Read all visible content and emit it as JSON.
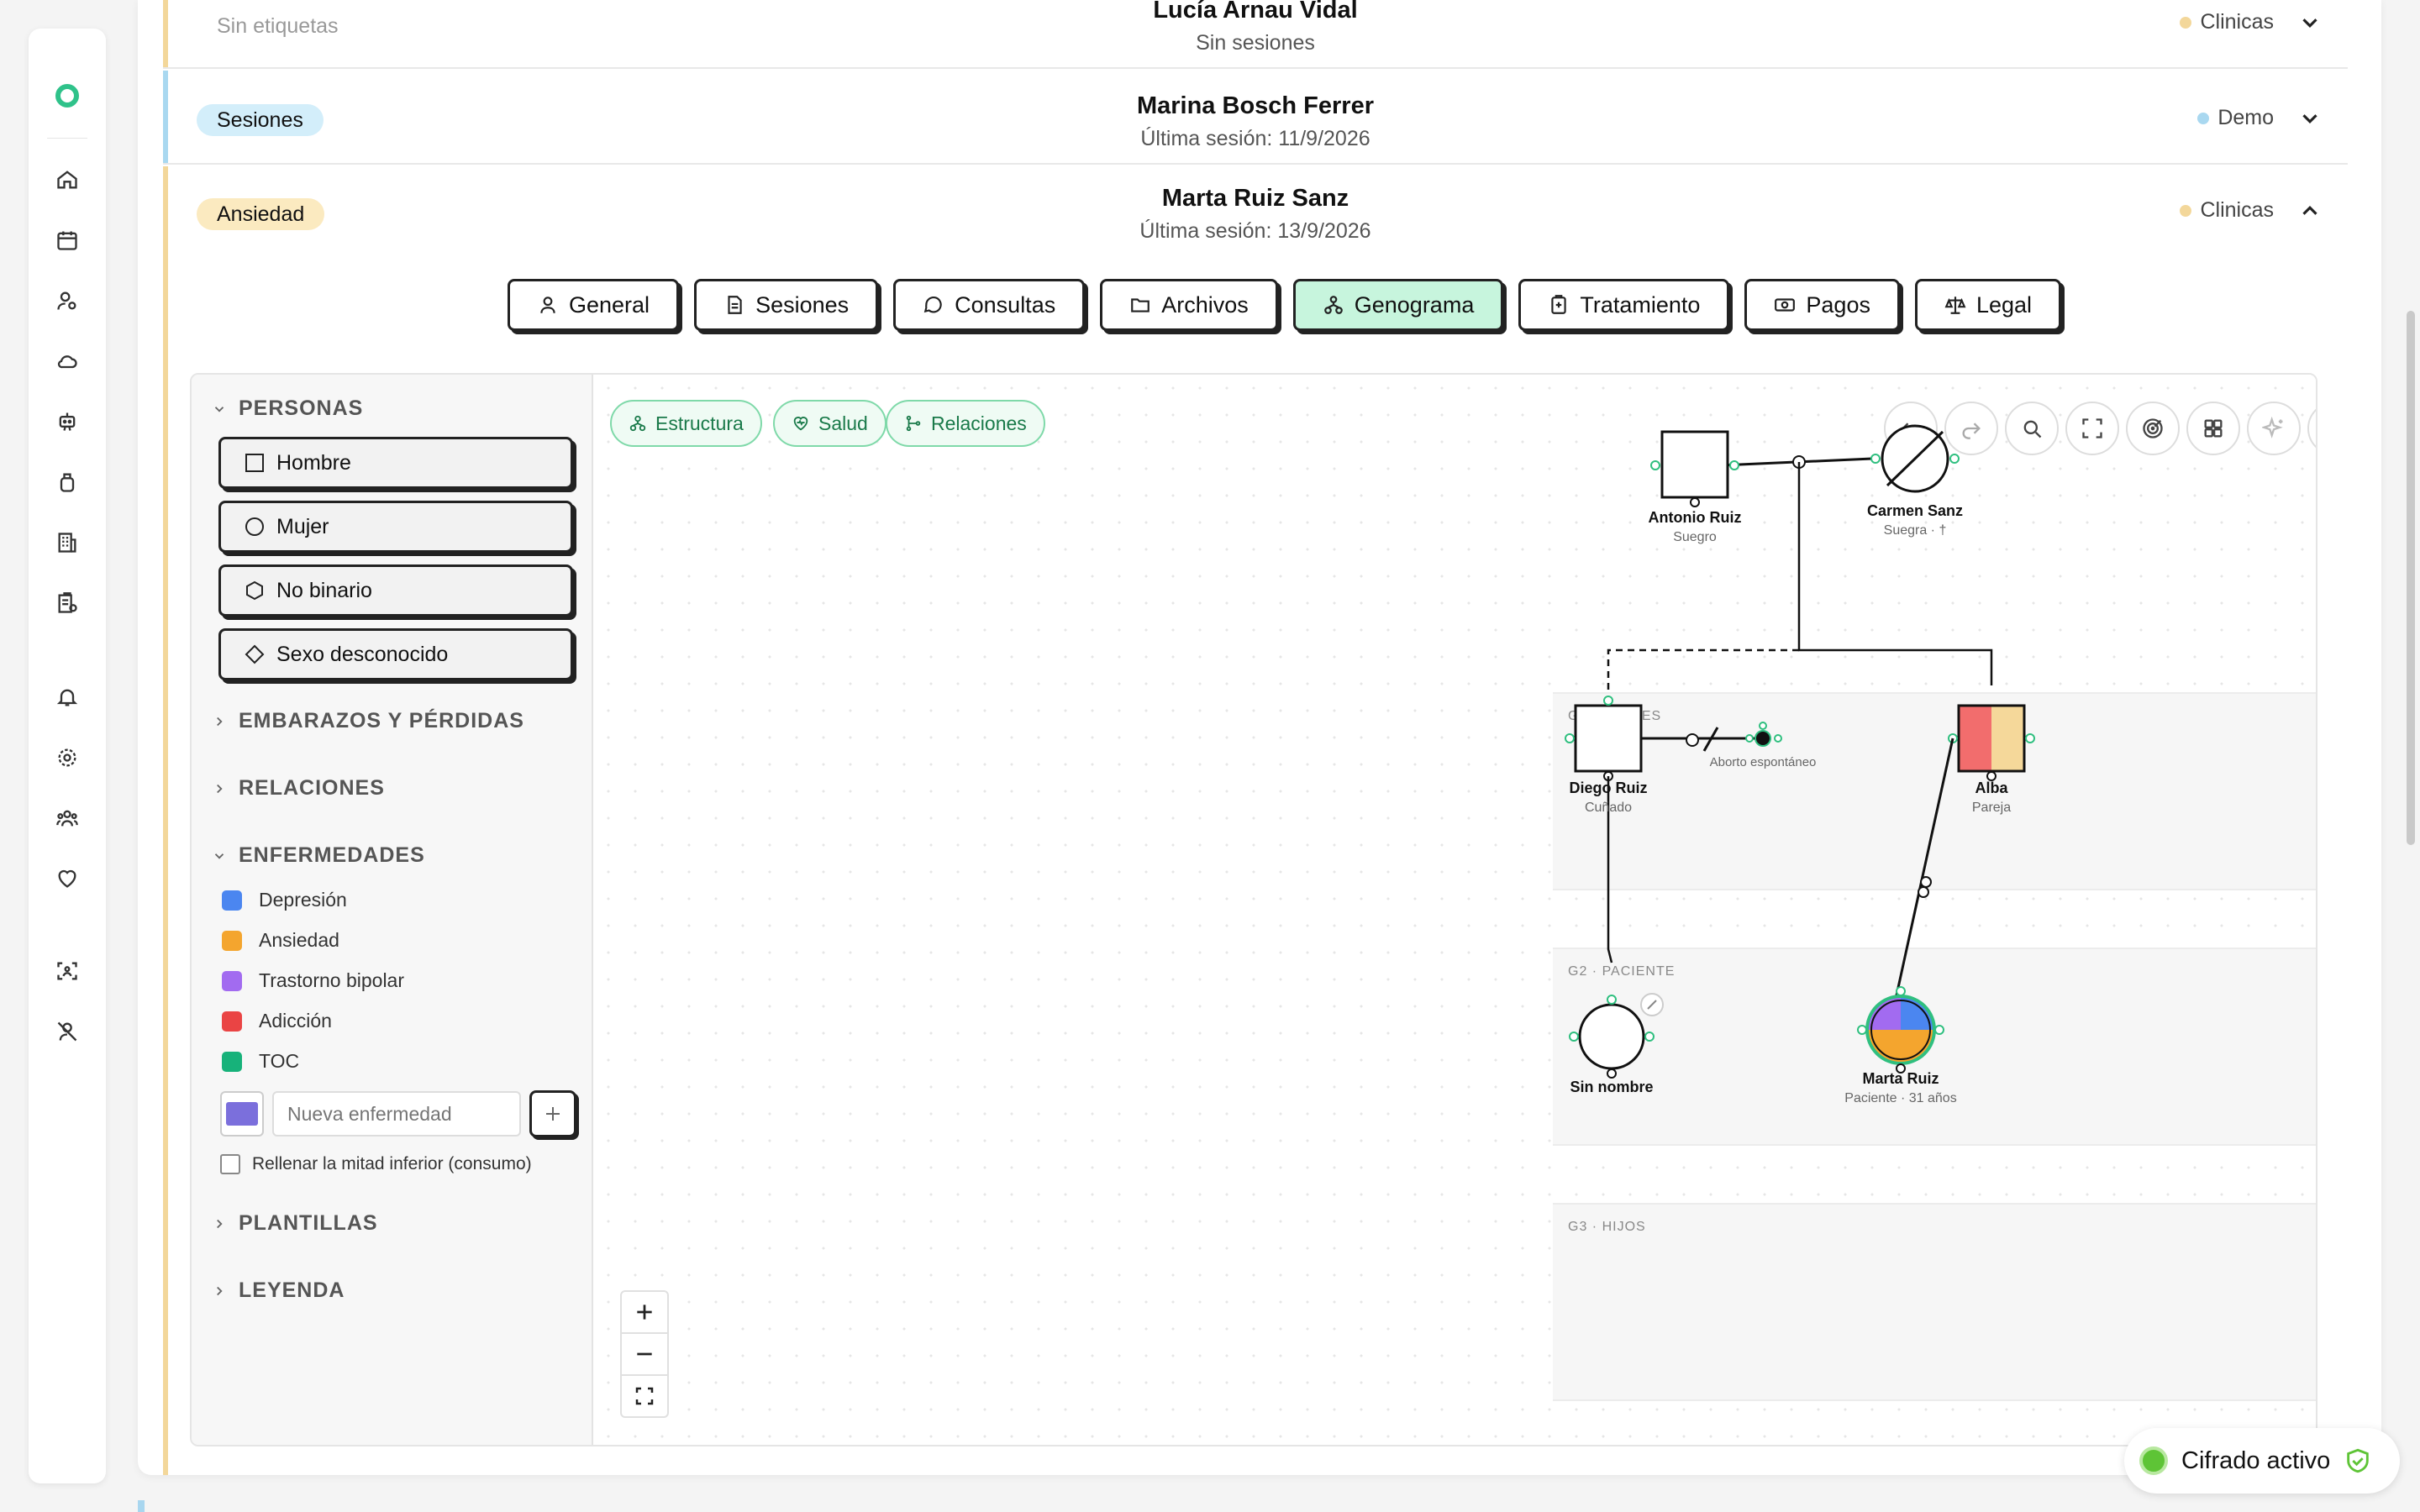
{
  "patients": [
    {
      "tag": "Sin etiquetas",
      "name": "Lucía Arnau Vidal",
      "sub": "Sin sesiones",
      "status": "Clinicas",
      "stripe": "#f3d79a",
      "status_color": "#f3d79a"
    },
    {
      "tag": "Sesiones",
      "name": "Marina Bosch Ferrer",
      "sub": "Última sesión: 11/9/2026",
      "status": "Demo",
      "stripe": "#a9d8f0",
      "status_color": "#a9d8f0",
      "tag_color": "#d3eefa"
    },
    {
      "tag": "Ansiedad",
      "name": "Marta Ruiz Sanz",
      "sub": "Última sesión: 13/9/2026",
      "status": "Clinicas",
      "stripe": "#f3d79a",
      "status_color": "#f3d79a",
      "tag_color": "#fbeac0"
    }
  ],
  "tabs": [
    "General",
    "Sesiones",
    "Consultas",
    "Archivos",
    "Genograma",
    "Tratamiento",
    "Pagos",
    "Legal"
  ],
  "active_tab": "Genograma",
  "sidebar": {
    "personas_title": "PERSONAS",
    "person_buttons": [
      "Hombre",
      "Mujer",
      "No binario",
      "Sexo desconocido"
    ],
    "embarazos_title": "EMBARAZOS Y PÉRDIDAS",
    "relaciones_title": "RELACIONES",
    "enfermedades_title": "ENFERMEDADES",
    "diseases": [
      {
        "name": "Depresión",
        "color": "#4b86f0"
      },
      {
        "name": "Ansiedad",
        "color": "#f4a52e"
      },
      {
        "name": "Trastorno bipolar",
        "color": "#a26bf0"
      },
      {
        "name": "Adicción",
        "color": "#ea4444"
      },
      {
        "name": "TOC",
        "color": "#17b27a"
      }
    ],
    "new_disease_placeholder": "Nueva enfermedad",
    "new_disease_color": "#7b6fdc",
    "half_fill_label": "Rellenar la mitad inferior (consumo)",
    "plantillas_title": "PLANTILLAS",
    "leyenda_title": "LEYENDA"
  },
  "canvas": {
    "chips": [
      "Estructura",
      "Salud",
      "Relaciones"
    ],
    "tools": [
      "undo-icon",
      "redo-icon",
      "search-icon",
      "fullscreen-icon",
      "target-icon",
      "grid-icon",
      "sparkle-icon",
      "eye-off-icon",
      "download-icon",
      "eraser-icon"
    ],
    "bands": [
      "G1 · PADRES",
      "G2 · PACIENTE",
      "G3 · HIJOS"
    ],
    "people": {
      "antonio": {
        "name": "Antonio Ruiz",
        "role": "Suegro"
      },
      "carmen": {
        "name": "Carmen Sanz",
        "role": "Suegra · †"
      },
      "diego": {
        "name": "Diego Ruiz",
        "role": "Cuñado"
      },
      "alba": {
        "name": "Alba",
        "role": "Pareja"
      },
      "sin_nombre": {
        "name": "Sin nombre",
        "role": ""
      },
      "marta": {
        "name": "Marta Ruiz",
        "role": "Paciente · 31 años"
      }
    },
    "aborto_label": "Aborto espontáneo"
  },
  "encryption": "Cifrado activo"
}
